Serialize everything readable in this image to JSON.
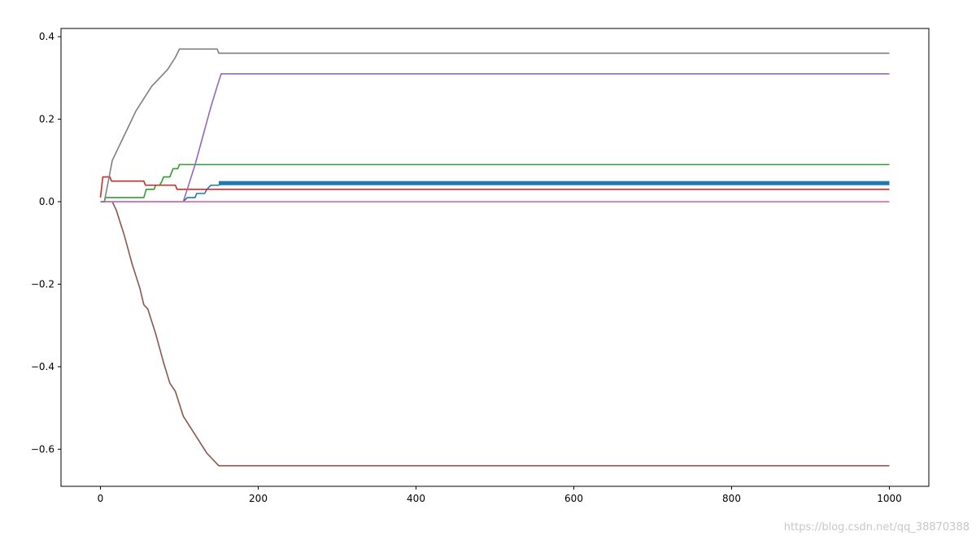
{
  "chart_data": {
    "type": "line",
    "title": "",
    "xlabel": "",
    "ylabel": "",
    "xlim": [
      -50,
      1050
    ],
    "ylim": [
      -0.69,
      0.42
    ],
    "xticks": [
      0,
      200,
      400,
      600,
      800,
      1000
    ],
    "xtick_labels": [
      "0",
      "200",
      "400",
      "600",
      "800",
      "1000"
    ],
    "yticks": [
      0.4,
      0.2,
      0.0,
      -0.2,
      -0.4,
      -0.6
    ],
    "ytick_labels": [
      "0.4",
      "0.2",
      "0.0",
      "−0.2",
      "−0.4",
      "−0.6"
    ],
    "grid": false,
    "legend": "none",
    "series": [
      {
        "color": "#1f77b4",
        "oscillating_band": true,
        "points": [
          [
            0,
            0.0
          ],
          [
            105,
            0.0
          ],
          [
            110,
            0.01
          ],
          [
            120,
            0.01
          ],
          [
            122,
            0.02
          ],
          [
            132,
            0.02
          ],
          [
            135,
            0.03
          ],
          [
            140,
            0.04
          ],
          [
            150,
            0.04
          ],
          [
            152,
            0.045
          ],
          [
            1000,
            0.045
          ]
        ],
        "band": [
          150,
          1000,
          0.04,
          0.05
        ]
      },
      {
        "color": "#ff7f0e",
        "points": [
          [
            0,
            0.0
          ],
          [
            1000,
            0.0
          ]
        ]
      },
      {
        "color": "#2ca02c",
        "points": [
          [
            0,
            0.0
          ],
          [
            5,
            0.0
          ],
          [
            6,
            0.01
          ],
          [
            55,
            0.01
          ],
          [
            58,
            0.03
          ],
          [
            68,
            0.03
          ],
          [
            70,
            0.04
          ],
          [
            75,
            0.04
          ],
          [
            78,
            0.05
          ],
          [
            80,
            0.06
          ],
          [
            88,
            0.06
          ],
          [
            92,
            0.08
          ],
          [
            98,
            0.08
          ],
          [
            100,
            0.09
          ],
          [
            1000,
            0.09
          ]
        ]
      },
      {
        "color": "#d62728",
        "points": [
          [
            0,
            0.01
          ],
          [
            3,
            0.06
          ],
          [
            12,
            0.06
          ],
          [
            14,
            0.05
          ],
          [
            55,
            0.05
          ],
          [
            57,
            0.04
          ],
          [
            95,
            0.04
          ],
          [
            97,
            0.03
          ],
          [
            1000,
            0.03
          ]
        ]
      },
      {
        "color": "#9467bd",
        "points": [
          [
            0,
            0.0
          ],
          [
            105,
            0.0
          ],
          [
            110,
            0.03
          ],
          [
            120,
            0.09
          ],
          [
            130,
            0.16
          ],
          [
            140,
            0.23
          ],
          [
            148,
            0.28
          ],
          [
            153,
            0.31
          ],
          [
            1000,
            0.31
          ]
        ]
      },
      {
        "color": "#8c564b",
        "points": [
          [
            0,
            0.0
          ],
          [
            15,
            0.0
          ],
          [
            20,
            -0.02
          ],
          [
            30,
            -0.08
          ],
          [
            40,
            -0.15
          ],
          [
            50,
            -0.21
          ],
          [
            55,
            -0.25
          ],
          [
            60,
            -0.26
          ],
          [
            70,
            -0.32
          ],
          [
            80,
            -0.39
          ],
          [
            88,
            -0.44
          ],
          [
            95,
            -0.46
          ],
          [
            105,
            -0.52
          ],
          [
            115,
            -0.55
          ],
          [
            125,
            -0.58
          ],
          [
            135,
            -0.61
          ],
          [
            145,
            -0.63
          ],
          [
            150,
            -0.64
          ],
          [
            1000,
            -0.64
          ]
        ]
      },
      {
        "color": "#e377c2",
        "points": [
          [
            0,
            0.0
          ],
          [
            1000,
            0.0
          ]
        ]
      },
      {
        "color": "#7f7f7f",
        "points": [
          [
            0,
            0.0
          ],
          [
            5,
            0.0
          ],
          [
            15,
            0.1
          ],
          [
            25,
            0.14
          ],
          [
            35,
            0.18
          ],
          [
            45,
            0.22
          ],
          [
            55,
            0.25
          ],
          [
            65,
            0.28
          ],
          [
            75,
            0.3
          ],
          [
            85,
            0.32
          ],
          [
            95,
            0.35
          ],
          [
            100,
            0.37
          ],
          [
            148,
            0.37
          ],
          [
            150,
            0.36
          ],
          [
            1000,
            0.36
          ]
        ]
      }
    ]
  },
  "watermark": "https://blog.csdn.net/qq_38870388"
}
